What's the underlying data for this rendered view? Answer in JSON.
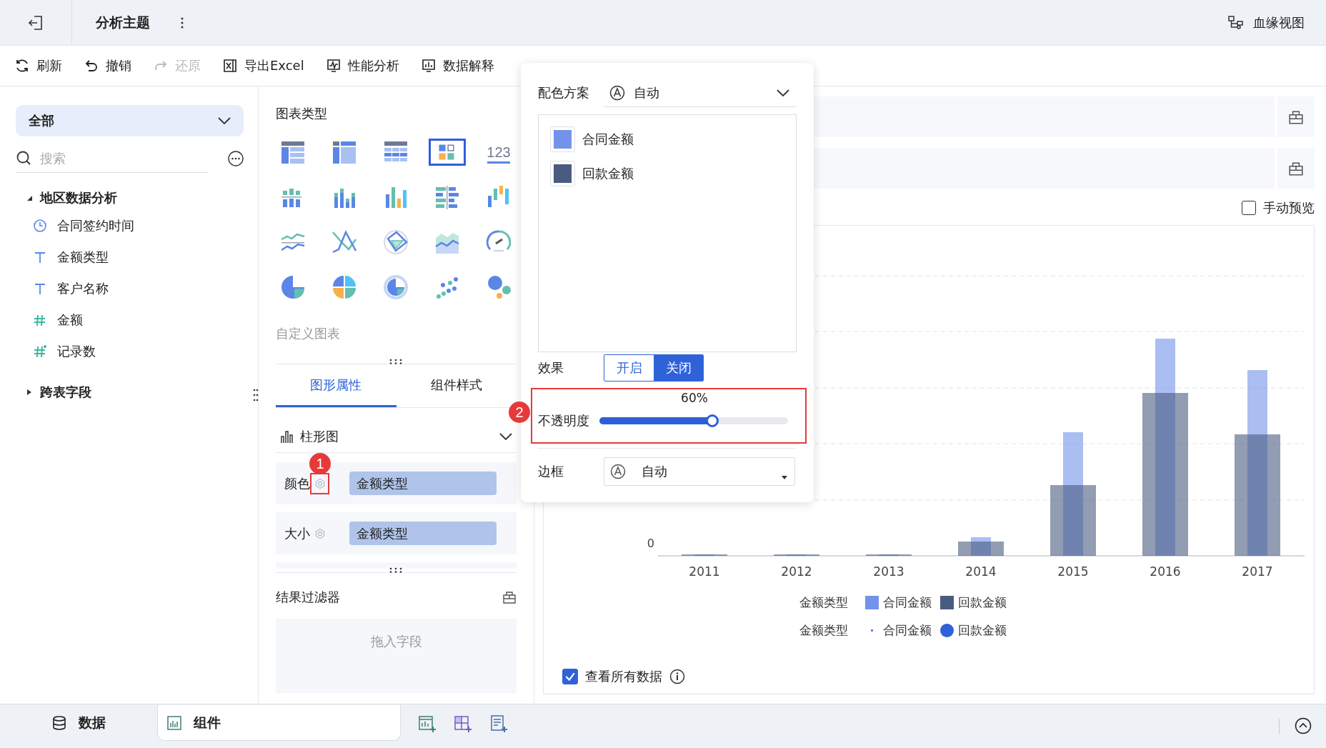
{
  "topbar": {
    "title": "分析主题",
    "lineage": "血缘视图"
  },
  "toolbar": [
    {
      "label": "刷新",
      "kind": "refresh",
      "disabled": false
    },
    {
      "label": "撤销",
      "kind": "undo",
      "disabled": false
    },
    {
      "label": "还原",
      "kind": "redo",
      "disabled": true
    },
    {
      "label": "导出Excel",
      "kind": "excel",
      "disabled": false
    },
    {
      "label": "性能分析",
      "kind": "performance",
      "disabled": false
    },
    {
      "label": "数据解释",
      "kind": "explain",
      "disabled": false
    }
  ],
  "data_panel": {
    "scope": "全部",
    "search": {
      "placeholder": "搜索"
    },
    "tree": [
      {
        "label": "地区数据分析",
        "expanded": true,
        "children": [
          {
            "label": "合同签约时间",
            "kind": "date"
          },
          {
            "label": "金额类型",
            "kind": "text"
          },
          {
            "label": "客户名称",
            "kind": "text"
          },
          {
            "label": "金额",
            "kind": "number"
          },
          {
            "label": "记录数",
            "kind": "count"
          }
        ]
      },
      {
        "label": "跨表字段",
        "expanded": false
      }
    ]
  },
  "chart_panel": {
    "heading": "图表类型",
    "chart_types": [
      {
        "kind": "table",
        "selected": false
      },
      {
        "kind": "crosstab",
        "selected": false
      },
      {
        "kind": "detail",
        "selected": false
      },
      {
        "kind": "composite",
        "selected": true
      },
      {
        "kind": "number",
        "label": "123",
        "selected": false
      },
      {
        "kind": "stacked",
        "selected": false
      },
      {
        "kind": "grouped",
        "selected": false
      },
      {
        "kind": "bar",
        "selected": false
      },
      {
        "kind": "hbar",
        "selected": false
      },
      {
        "kind": "range",
        "selected": false
      },
      {
        "kind": "line",
        "selected": false
      },
      {
        "kind": "crossline",
        "selected": false
      },
      {
        "kind": "radar",
        "selected": false
      },
      {
        "kind": "area",
        "selected": false
      },
      {
        "kind": "gauge",
        "selected": false
      },
      {
        "kind": "pie",
        "selected": false
      },
      {
        "kind": "multipie",
        "selected": false
      },
      {
        "kind": "ring",
        "selected": false
      },
      {
        "kind": "scatter",
        "selected": false
      },
      {
        "kind": "bubble",
        "selected": false
      }
    ],
    "custom": "自定义图表",
    "tabs": [
      {
        "label": "图形属性",
        "selected": true
      },
      {
        "label": "组件样式",
        "selected": false
      }
    ],
    "chart_kind": "柱形图",
    "properties": [
      {
        "label": "颜色",
        "field": "金额类型",
        "highlighted": true,
        "marker": "1"
      },
      {
        "label": "大小",
        "field": "金额类型",
        "highlighted": false
      }
    ],
    "filter": {
      "title": "结果过滤器",
      "placeholder": "拖入字段"
    }
  },
  "preview": {
    "manual_preview": {
      "label": "手动预览",
      "checked": false
    },
    "chart": {
      "y_zero": "0",
      "x_labels": [
        "2011",
        "2012",
        "2013",
        "2014",
        "2015",
        "2016",
        "2017"
      ],
      "legends": [
        {
          "title": "金额类型",
          "items": [
            {
              "label": "合同金额",
              "kind": "square",
              "color": "#7393ea"
            },
            {
              "label": "回款金额",
              "kind": "square",
              "color": "#4a5b80"
            }
          ]
        },
        {
          "title": "金额类型",
          "items": [
            {
              "label": "合同金额",
              "kind": "small-dot"
            },
            {
              "label": "回款金额",
              "kind": "large-dot"
            }
          ]
        }
      ]
    },
    "view_all": {
      "label": "查看所有数据",
      "checked": true
    }
  },
  "popover": {
    "scheme": {
      "label": "配色方案",
      "value": "自动"
    },
    "colors": [
      {
        "label": "合同金额",
        "color": "#7393ea"
      },
      {
        "label": "回款金额",
        "color": "#4a5b80"
      }
    ],
    "effect": {
      "label": "效果",
      "options": [
        {
          "label": "开启",
          "selected": false
        },
        {
          "label": "关闭",
          "selected": true
        }
      ]
    },
    "opacity": {
      "label": "不透明度",
      "reading": "60%",
      "level": 0.6,
      "highlighted": true,
      "marker": "2"
    },
    "border": {
      "label": "边框",
      "value": "自动"
    }
  },
  "bottom_bar": {
    "tabs": [
      {
        "label": "数据",
        "kind": "data",
        "selected": false
      },
      {
        "label": "组件",
        "kind": "component",
        "selected": true
      }
    ]
  }
}
